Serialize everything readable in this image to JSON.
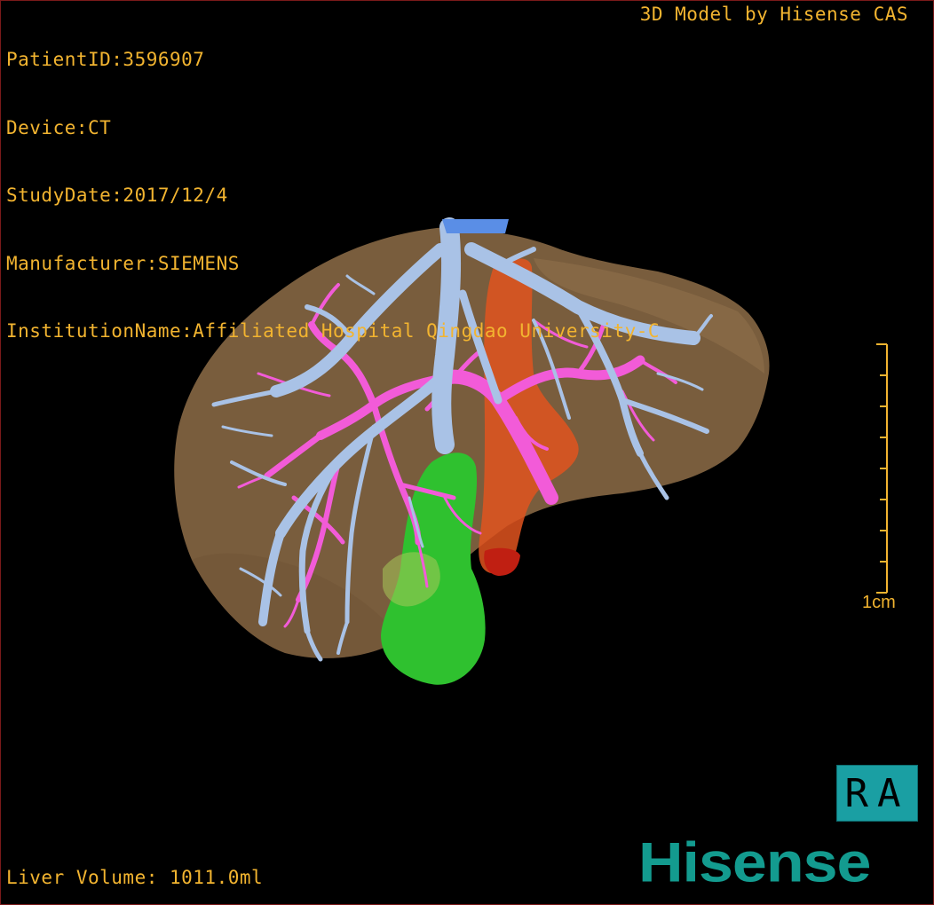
{
  "header": {
    "patient_id": "PatientID:3596907",
    "device": "Device:CT",
    "study_date": "StudyDate:2017/12/4",
    "manufacturer": "Manufacturer:SIEMENS",
    "institution": "InstitutionName:Affiliated Hospital Qingdao University-C",
    "vendor_title": "3D Model by Hisense CAS"
  },
  "scale": {
    "label": "1cm"
  },
  "orientation": {
    "label": "RA"
  },
  "footer": {
    "liver_volume": "Liver Volume: 1011.0ml",
    "logo_text": "Hisense"
  },
  "colors": {
    "overlay_text": "#f2b430",
    "liver": "#8a6a45",
    "hepatic_veins": "#a9c2e6",
    "portal_vein": "#f25bd8",
    "gallbladder": "#2fc12f",
    "ivc": "#e0301f",
    "orientation_box": "#1a9fa3",
    "logo": "#139b8f"
  }
}
